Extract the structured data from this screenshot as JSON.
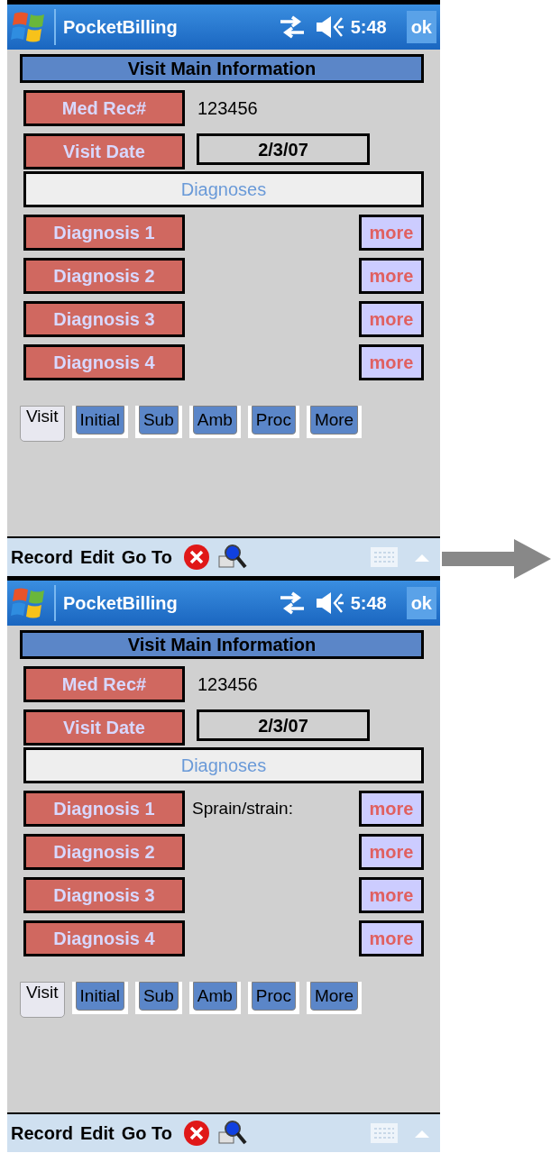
{
  "screens": [
    {
      "title_bar": {
        "title": "PocketBilling",
        "time": "5:48",
        "ok": "ok"
      },
      "header": "Visit Main Information",
      "med_rec": {
        "label": "Med Rec#",
        "value": "123456"
      },
      "visit_date": {
        "label": "Visit Date",
        "value": "2/3/07"
      },
      "diagnoses_heading": "Diagnoses",
      "diagnoses": [
        {
          "label": "Diagnosis 1",
          "more": "more"
        },
        {
          "label": "Diagnosis 2",
          "more": "more"
        },
        {
          "label": "Diagnosis 3",
          "more": "more"
        },
        {
          "label": "Diagnosis 4",
          "more": "more"
        }
      ],
      "tabs": [
        {
          "label": "Visit",
          "selected": true
        },
        {
          "label": "Initial",
          "selected": false
        },
        {
          "label": "Sub",
          "selected": false
        },
        {
          "label": "Amb",
          "selected": false
        },
        {
          "label": "Proc",
          "selected": false
        },
        {
          "label": "More",
          "selected": false
        }
      ],
      "menu": [
        "Record",
        "Edit",
        "Go To"
      ]
    },
    {
      "title_bar": {
        "title": "PocketBilling",
        "time": "5:48",
        "ok": "ok"
      },
      "header": "Visit Main Information",
      "med_rec": {
        "label": "Med Rec#",
        "value": "123456"
      },
      "visit_date": {
        "label": "Visit Date",
        "value": "2/3/07"
      },
      "diagnoses_heading": "Diagnoses",
      "diagnoses": [
        {
          "label": "Diagnosis 1",
          "value": "Sprain/strain:",
          "more": "more"
        },
        {
          "label": "Diagnosis 2",
          "more": "more"
        },
        {
          "label": "Diagnosis 3",
          "more": "more"
        },
        {
          "label": "Diagnosis 4",
          "more": "more"
        }
      ],
      "tabs": [
        {
          "label": "Visit",
          "selected": true
        },
        {
          "label": "Initial",
          "selected": false
        },
        {
          "label": "Sub",
          "selected": false
        },
        {
          "label": "Amb",
          "selected": false
        },
        {
          "label": "Proc",
          "selected": false
        },
        {
          "label": "More",
          "selected": false
        }
      ],
      "menu": [
        "Record",
        "Edit",
        "Go To"
      ]
    }
  ]
}
